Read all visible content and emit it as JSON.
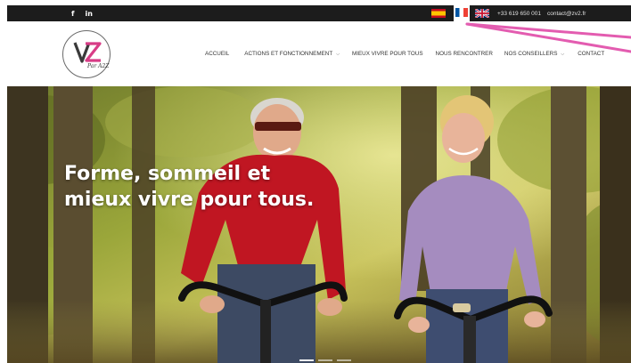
{
  "topbar": {
    "social": [
      {
        "label": "f",
        "icon": "facebook-icon"
      },
      {
        "label": "in",
        "icon": "linkedin-icon"
      }
    ],
    "languages": [
      {
        "icon": "spain-flag-icon",
        "lang": "es"
      },
      {
        "icon": "france-flag-icon",
        "lang": "fr",
        "active": true
      },
      {
        "icon": "uk-flag-icon",
        "lang": "en"
      }
    ],
    "phone": "+33 619 650 001",
    "email": "contact@zv2.fr"
  },
  "header": {
    "logo_mark": "VZ",
    "logo_sub": "Par A2Z",
    "nav": [
      {
        "label": "ACCUEIL",
        "dropdown": false
      },
      {
        "label": "ACTIONS ET FONCTIONNEMENT",
        "dropdown": true
      },
      {
        "label": "MIEUX VIVRE POUR TOUS",
        "dropdown": false
      },
      {
        "label": "NOUS RENCONTRER",
        "dropdown": false
      },
      {
        "label": "NOS CONSEILLERS",
        "dropdown": true
      },
      {
        "label": "CONTACT",
        "dropdown": false
      }
    ]
  },
  "hero": {
    "title_line1": "Forme, sommeil et",
    "title_line2": "mieux vivre pour tous.",
    "slides": 3,
    "active_slide": 1
  },
  "colors": {
    "topbar_bg": "#1c1c1c",
    "brand_pink": "#d83c86",
    "annotation_arrow": "#e35cb0"
  }
}
